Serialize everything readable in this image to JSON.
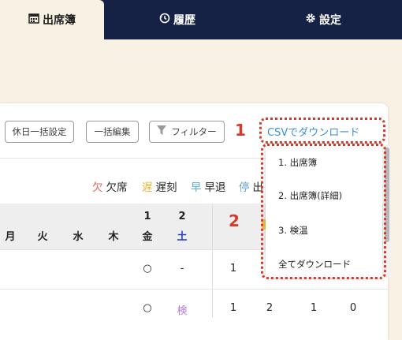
{
  "nav": {
    "tabs": [
      {
        "label": "出席簿",
        "icon": "calendar-icon"
      },
      {
        "label": "履歴",
        "icon": "history-icon"
      },
      {
        "label": "設定",
        "icon": "gear-icon"
      }
    ]
  },
  "toolbar": {
    "holiday_bulk": "休日一括設定",
    "bulk_edit": "一括編集",
    "filter": "フィルター",
    "csv": "CSVでダウンロード"
  },
  "callouts": {
    "one": "1",
    "two": "2"
  },
  "legend": [
    {
      "char": "欠",
      "label": "欠席",
      "color": "#e0645a"
    },
    {
      "char": "遅",
      "label": "遅刻",
      "color": "#e8b23a"
    },
    {
      "char": "早",
      "label": "早退",
      "color": "#5aaad8"
    },
    {
      "char": "停",
      "label": "出",
      "color": "#6a9fd0"
    }
  ],
  "table": {
    "weekday_headers": [
      "月",
      "火",
      "水",
      "木"
    ],
    "date_cols": [
      {
        "num": "1",
        "day": "金",
        "color": "#222222"
      },
      {
        "num": "2",
        "day": "土",
        "color": "#1a3fd0"
      }
    ],
    "rows": [
      {
        "c1": "○",
        "c2": "-",
        "c3": "1",
        "c4": "",
        "c5": "",
        "c6": ""
      },
      {
        "c1": "○",
        "c2": "検",
        "c3": "1",
        "c4": "2",
        "c5": "1",
        "c6": "0"
      }
    ]
  },
  "dropdown": {
    "items": [
      "1. 出席簿",
      "2. 出席簿(詳細)",
      "3. 検温",
      "全てダウンロード"
    ]
  }
}
